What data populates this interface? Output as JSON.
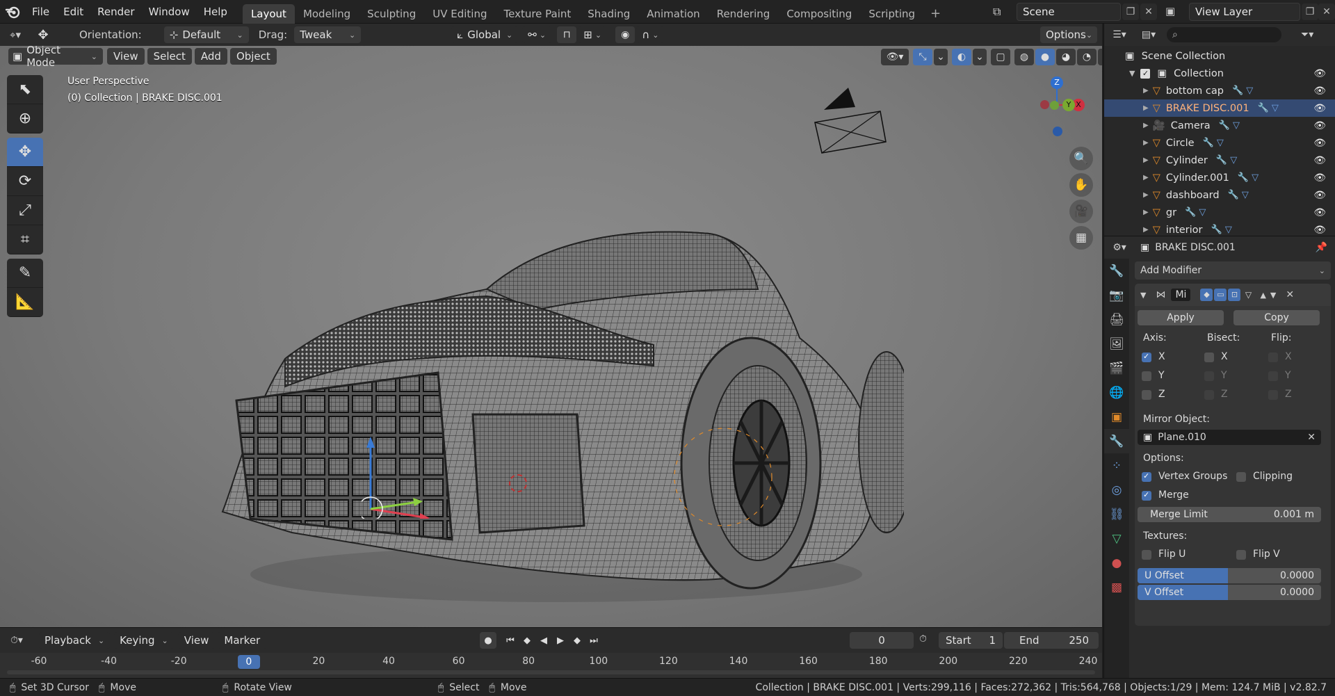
{
  "menu": [
    "File",
    "Edit",
    "Render",
    "Window",
    "Help"
  ],
  "workspaces": [
    "Layout",
    "Modeling",
    "Sculpting",
    "UV Editing",
    "Texture Paint",
    "Shading",
    "Animation",
    "Rendering",
    "Compositing",
    "Scripting"
  ],
  "active_workspace": "Layout",
  "scene": {
    "name": "Scene",
    "view_layer": "View Layer"
  },
  "tool_header": {
    "orientation_label": "Orientation:",
    "orientation_value": "Default",
    "drag_label": "Drag:",
    "drag_value": "Tweak",
    "transform_orientation": "Global",
    "options_label": "Options"
  },
  "viewport_header": {
    "mode": "Object Mode",
    "view": "View",
    "select": "Select",
    "add": "Add",
    "object": "Object"
  },
  "viewport": {
    "perspective": "User Perspective",
    "context": "(0) Collection | BRAKE DISC.001",
    "gizmo_axes": {
      "x": "X",
      "y": "Y",
      "z": "Z"
    }
  },
  "outliner": {
    "scene_collection": "Scene Collection",
    "collection": "Collection",
    "items": [
      {
        "name": "bottom cap",
        "icon": "mesh-icon"
      },
      {
        "name": "BRAKE DISC.001",
        "icon": "mesh-icon",
        "selected": true
      },
      {
        "name": "Camera",
        "icon": "camera-icon"
      },
      {
        "name": "Circle",
        "icon": "mesh-icon"
      },
      {
        "name": "Cylinder",
        "icon": "mesh-icon"
      },
      {
        "name": "Cylinder.001",
        "icon": "mesh-icon"
      },
      {
        "name": "dashboard",
        "icon": "mesh-icon"
      },
      {
        "name": "gr",
        "icon": "mesh-icon"
      },
      {
        "name": "interior",
        "icon": "mesh-icon"
      }
    ]
  },
  "properties": {
    "object_name": "BRAKE DISC.001",
    "add_modifier": "Add Modifier",
    "modifier_name": "Mi",
    "apply": "Apply",
    "copy": "Copy",
    "axis_label": "Axis:",
    "bisect_label": "Bisect:",
    "flip_label": "Flip:",
    "axis": {
      "x": "X",
      "y": "Y",
      "z": "Z"
    },
    "axis_checked": {
      "x": true,
      "y": false,
      "z": false
    },
    "mirror_object_label": "Mirror Object:",
    "mirror_object": "Plane.010",
    "options_label": "Options:",
    "vertex_groups": "Vertex Groups",
    "clipping": "Clipping",
    "merge": "Merge",
    "merge_limit_label": "Merge Limit",
    "merge_limit_value": "0.001 m",
    "textures_label": "Textures:",
    "flip_u": "Flip U",
    "flip_v": "Flip V",
    "u_offset_label": "U Offset",
    "u_offset_value": "0.0000",
    "v_offset_label": "V Offset",
    "v_offset_value": "0.0000"
  },
  "timeline": {
    "playback": "Playback",
    "keying": "Keying",
    "view": "View",
    "marker": "Marker",
    "current_frame": "0",
    "start_label": "Start",
    "start_value": "1",
    "end_label": "End",
    "end_value": "250",
    "ticks": [
      "-60",
      "-40",
      "-20",
      "0",
      "20",
      "40",
      "60",
      "80",
      "100",
      "120",
      "140",
      "160",
      "180",
      "200",
      "220",
      "240"
    ]
  },
  "statusbar": {
    "set_cursor": "Set 3D Cursor",
    "move": "Move",
    "rotate_view": "Rotate View",
    "select": "Select",
    "move2": "Move",
    "stats": "Collection | BRAKE DISC.001 | Verts:299,116 | Faces:272,362 | Tris:564,768 | Objects:1/29 | Mem: 124.7 MiB | v2.82.7"
  }
}
